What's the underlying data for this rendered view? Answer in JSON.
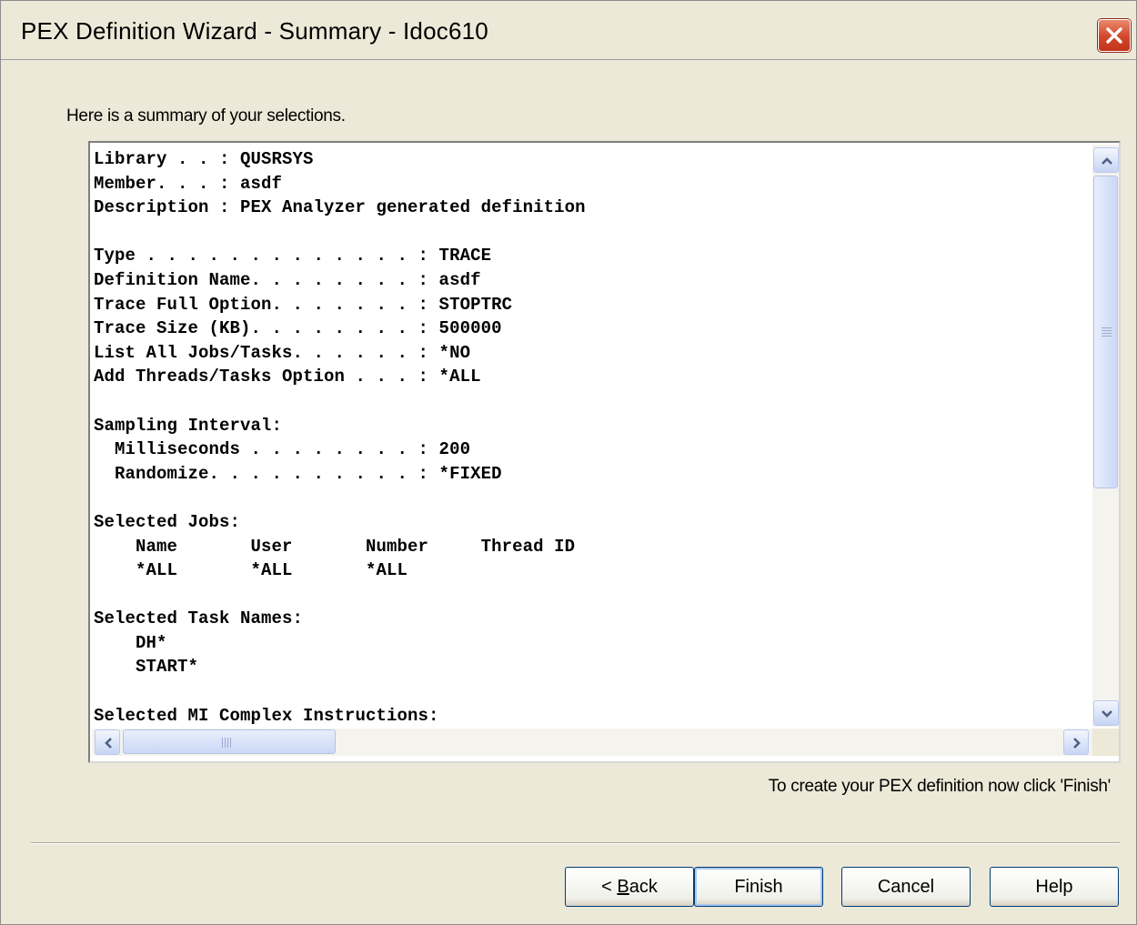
{
  "window": {
    "title": "PEX Definition Wizard - Summary - Idoc610"
  },
  "intro_text": "Here is a summary of your selections.",
  "summary_lines": [
    "Library . . : QUSRSYS",
    "Member. . . : asdf",
    "Description : PEX Analyzer generated definition",
    "",
    "Type . . . . . . . . . . . . . : TRACE",
    "Definition Name. . . . . . . . : asdf",
    "Trace Full Option. . . . . . . : STOPTRC",
    "Trace Size (KB). . . . . . . . : 500000",
    "List All Jobs/Tasks. . . . . . : *NO",
    "Add Threads/Tasks Option . . . : *ALL",
    "",
    "Sampling Interval:",
    "  Milliseconds . . . . . . . . : 200",
    "  Randomize. . . . . . . . . . : *FIXED",
    "",
    "Selected Jobs:",
    "    Name       User       Number     Thread ID",
    "    *ALL       *ALL       *ALL",
    "",
    "Selected Task Names:",
    "    DH*",
    "    START*",
    "",
    "Selected MI Complex Instructions:"
  ],
  "finish_hint": "To create your PEX definition now click 'Finish'",
  "buttons": {
    "back_prefix": "< ",
    "back_mnemonic": "B",
    "back_rest": "ack",
    "finish": "Finish",
    "cancel": "Cancel",
    "help": "Help"
  },
  "icons": {
    "close": "close-x-icon",
    "scroll_up": "arrow-up-icon",
    "scroll_down": "arrow-down-icon",
    "scroll_left": "arrow-left-icon",
    "scroll_right": "arrow-right-icon"
  },
  "colors": {
    "dialog_bg": "#ece9d8",
    "close_button": "#d2462b",
    "scrollbar_accent": "#c7d5f4"
  }
}
